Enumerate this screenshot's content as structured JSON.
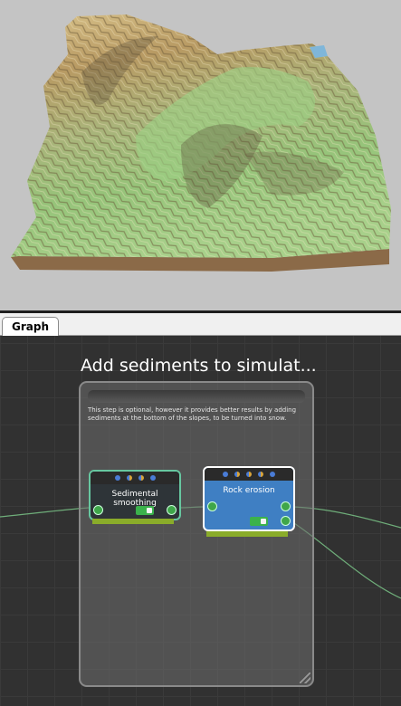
{
  "tabs": {
    "graph": "Graph"
  },
  "group": {
    "title": "Add sediments to simulat...",
    "description": "This step is optional, however it provides better results by adding sediments at the bottom of the slopes, to be turned into snow."
  },
  "nodes": {
    "sedimental": {
      "title": "Sedimental smoothing",
      "enabled": true
    },
    "rock": {
      "title": "Rock erosion",
      "enabled": true
    }
  },
  "colors": {
    "graph_bg": "#313131",
    "wire": "#6fae7a",
    "node_active": "#3f7fc3",
    "toggle_on": "#3bb24c",
    "underbar": "#8aac2a"
  }
}
